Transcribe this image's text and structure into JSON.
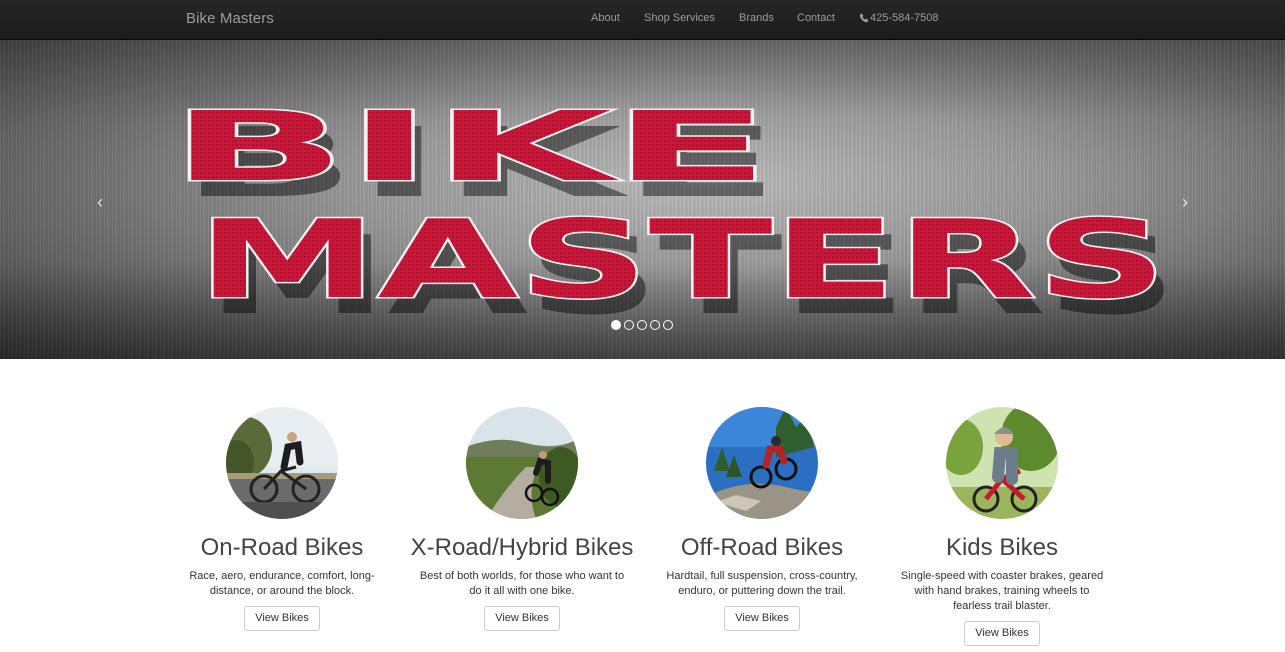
{
  "navbar": {
    "brand": "Bike Masters",
    "links": [
      "About",
      "Shop Services",
      "Brands",
      "Contact"
    ],
    "phone": "425-584-7508",
    "phone_icon": "phone-icon"
  },
  "carousel": {
    "logo_line1": "BIKE",
    "logo_line2": "MASTERS",
    "prev_glyph": "‹",
    "next_glyph": "›",
    "slides": 5,
    "active_slide": 1,
    "colors": {
      "logo_red": "#c8183a",
      "logo_outline": "#f2f2f2"
    }
  },
  "categories": [
    {
      "title": "On-Road Bikes",
      "description": "Race, aero, endurance, comfort, long-distance, or around the block.",
      "button": "View Bikes"
    },
    {
      "title": "X-Road/Hybrid Bikes",
      "description": "Best of both worlds, for those who want to do it all with one bike.",
      "button": "View Bikes"
    },
    {
      "title": "Off-Road Bikes",
      "description": "Hardtail, full suspension, cross-country, enduro, or puttering down the trail.",
      "button": "View Bikes"
    },
    {
      "title": "Kids Bikes",
      "description": "Single-speed with coaster brakes, geared with hand brakes, training wheels to fearless trail blaster.",
      "button": "View Bikes"
    }
  ]
}
